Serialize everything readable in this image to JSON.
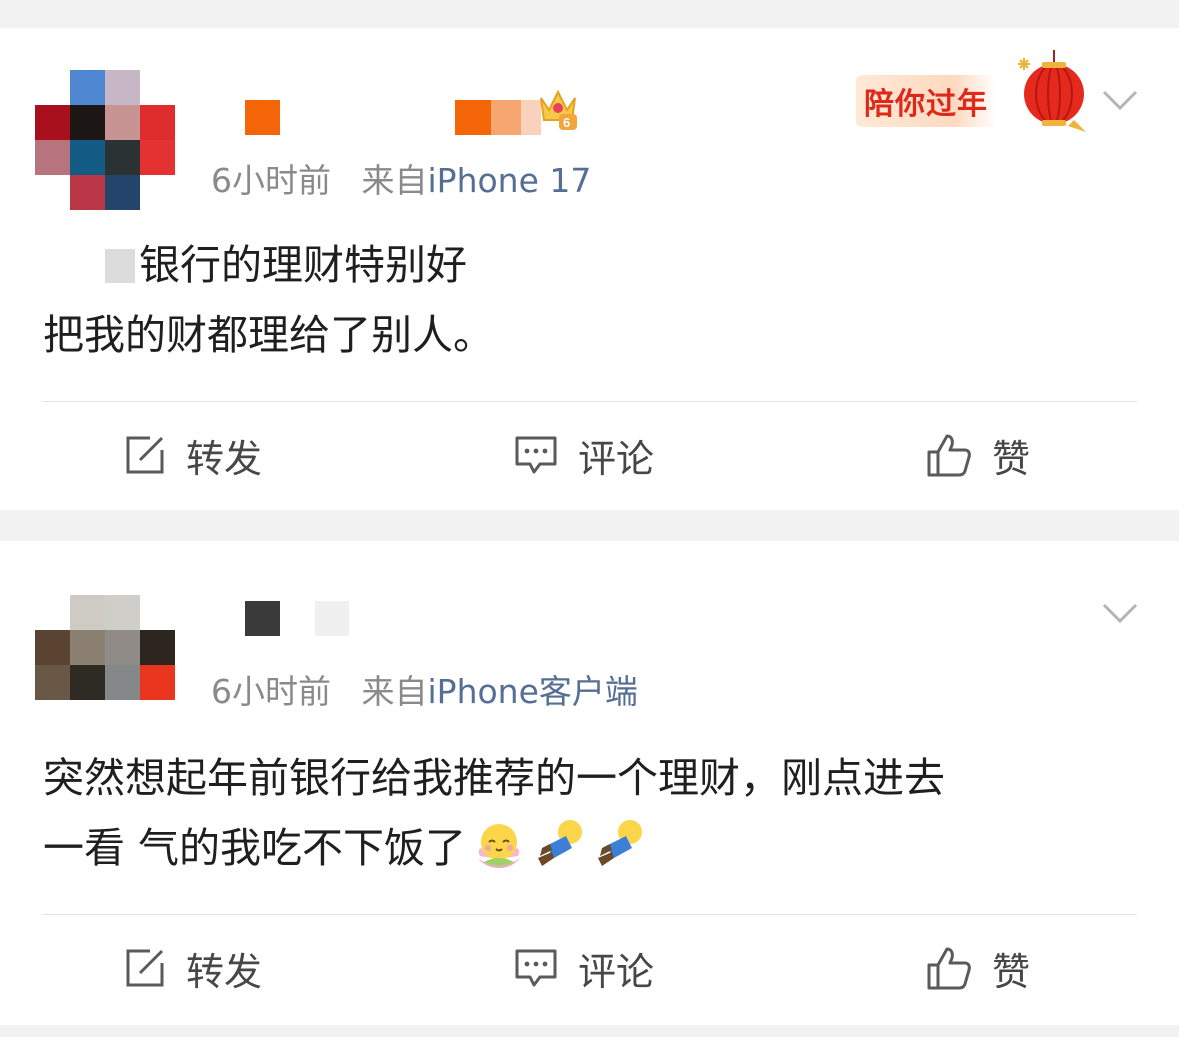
{
  "posts": [
    {
      "time": "6小时前",
      "from_label": "来自",
      "source": "iPhone 17",
      "badge": {
        "label": "陪你过年",
        "level": "6"
      },
      "text_lines": [
        "银行的理财特别好",
        "把我的财都理给了别人。"
      ],
      "actions": {
        "repost": "转发",
        "comment": "评论",
        "like": "赞"
      }
    },
    {
      "time": "6小时前",
      "from_label": "来自",
      "source": "iPhone客户端",
      "text_lines": [
        "突然想起年前银行给我推荐的一个理财，刚点进去",
        "一看 气的我吃不下饭了"
      ],
      "emojis": [
        "lotus-smile-emoji",
        "faint-emoji",
        "faint-emoji"
      ],
      "actions": {
        "repost": "转发",
        "comment": "评论",
        "like": "赞"
      }
    }
  ],
  "colors": {
    "source_link": "#556e94",
    "meta_gray": "#8a8a8a",
    "text": "#1f1f1f",
    "badge_red": "#e0281a"
  }
}
